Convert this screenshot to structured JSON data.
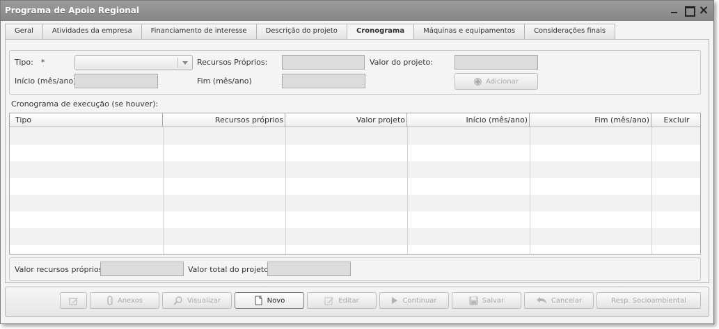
{
  "window": {
    "title": "Programa de Apoio Regional"
  },
  "tabs": [
    {
      "label": "Geral"
    },
    {
      "label": "Atividades da empresa"
    },
    {
      "label": "Financiamento de interesse"
    },
    {
      "label": "Descrição do projeto"
    },
    {
      "label": "Cronograma"
    },
    {
      "label": "Máquinas e equipamentos"
    },
    {
      "label": "Considerações finais"
    }
  ],
  "form": {
    "tipo_label": "Tipo:",
    "required_mark": "*",
    "tipo_value": "",
    "recursos_label": "Recursos Próprios:",
    "recursos_value": "",
    "valor_projeto_label": "Valor do projeto:",
    "valor_projeto_value": "",
    "inicio_label": "Início (mês/ano)",
    "inicio_value": "",
    "fim_label": "Fim (mês/ano)",
    "fim_value": "",
    "adicionar_label": "Adicionar"
  },
  "grid": {
    "title": "Cronograma de execução (se houver):",
    "columns": [
      "Tipo",
      "Recursos próprios",
      "Valor projeto",
      "Início (mês/ano)",
      "Fim (mês/ano)",
      "Excluir"
    ],
    "rows": []
  },
  "totals": {
    "recursos_label": "Valor recursos próprios:",
    "recursos_value": "",
    "total_label": "Valor total do projeto:",
    "total_value": ""
  },
  "toolbar": {
    "anexos": "Anexos",
    "visualizar": "Visualizar",
    "novo": "Novo",
    "editar": "Editar",
    "continuar": "Continuar",
    "salvar": "Salvar",
    "cancelar": "Cancelar",
    "resp": "Resp. Socioambiental"
  },
  "icons": {
    "minimize": "minimize-icon",
    "maximize": "maximize-icon",
    "close": "close-icon",
    "add": "plus-icon",
    "anexos": "paperclip-icon",
    "visualizar": "magnifier-icon",
    "novo": "new-document-icon",
    "editar": "pencil-icon",
    "continuar": "play-icon",
    "salvar": "floppy-icon",
    "cancelar": "undo-icon",
    "first": "edit-form-icon"
  }
}
